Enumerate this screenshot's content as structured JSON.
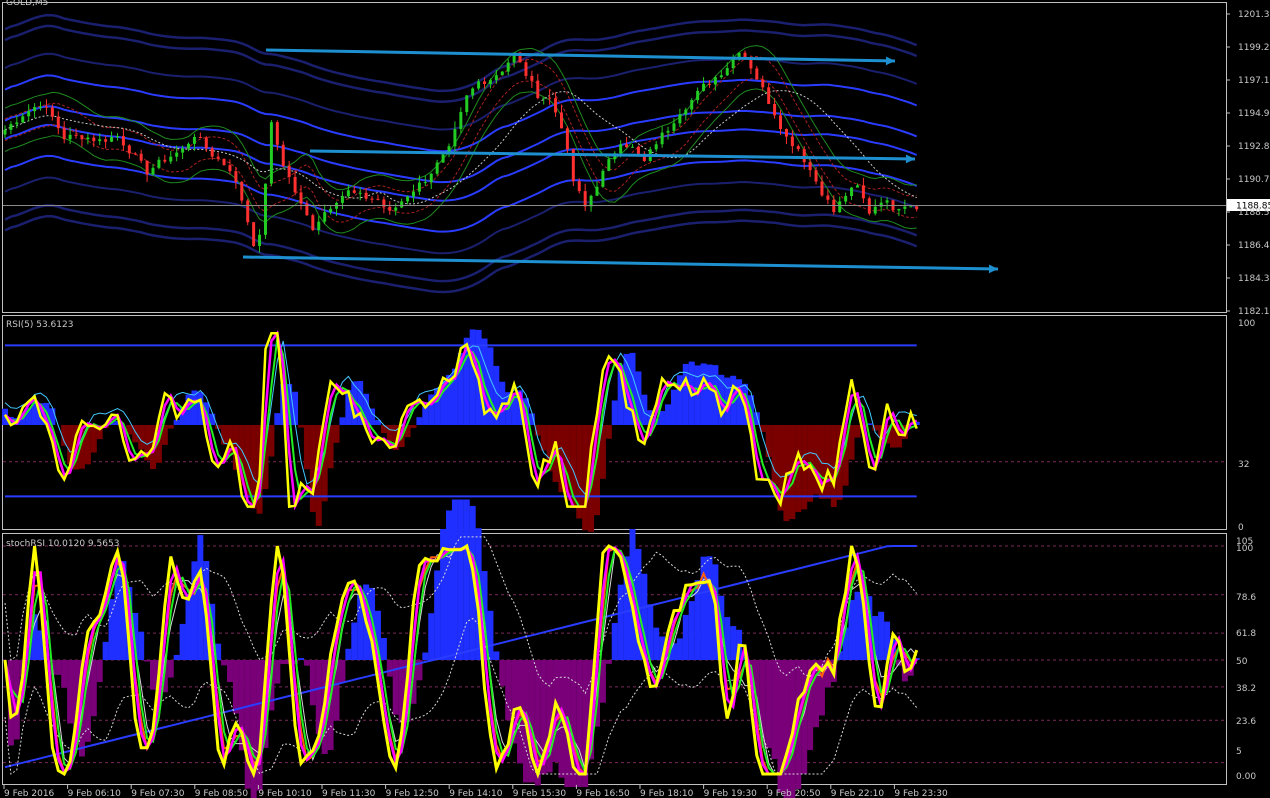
{
  "window": {
    "title_fragment": "GOLD,M5"
  },
  "colors": {
    "background": "#000000",
    "pane_border": "#c0c0c0",
    "bull_candle": "#22cc22",
    "bear_candle": "#ff3030",
    "trend_line": "#1e90d0",
    "band_navy": "#1a1f6e",
    "band_blue": "#2a3cff",
    "rsi_yellow": "#ffff00",
    "rsi_magenta": "#ff00ff",
    "rsi_green": "#22ee22",
    "rsi_cyan": "#44c8ff",
    "hist_pos": "#1f2fff",
    "hist_neg_rsi": "#7a0000",
    "hist_neg_stoch": "#7a007a",
    "stoch_orange": "#ff6010",
    "stoch_white": "#d8d8d8",
    "level_dash": "#7a2a5a"
  },
  "price_pane": {
    "label": "GOLD,M5",
    "current_price": "1188.85",
    "y_ticks": [
      "1201.35",
      "1199.20",
      "1197.10",
      "1194.95",
      "1192.80",
      "1190.70",
      "1188.55",
      "1186.40",
      "1184.30",
      "1182.15"
    ]
  },
  "rsi_pane": {
    "label": "RSI(5) 53.6123",
    "y_ticks": [
      "100",
      "32",
      "0"
    ]
  },
  "stoch_pane": {
    "label": "stochRSI 10.0120 9.5653",
    "y_ticks": [
      "105",
      "100",
      "78.6",
      "61.8",
      "50",
      "38.2",
      "23.6",
      "5",
      "0.00"
    ]
  },
  "x_axis": {
    "ticks": [
      "9 Feb 2016",
      "9 Feb 06:10",
      "9 Feb 07:30",
      "9 Feb 08:50",
      "9 Feb 10:10",
      "9 Feb 11:30",
      "9 Feb 12:50",
      "9 Feb 14:10",
      "9 Feb 15:30",
      "9 Feb 16:50",
      "9 Feb 18:10",
      "9 Feb 19:30",
      "9 Feb 20:50",
      "9 Feb 22:10",
      "9 Feb 23:30"
    ]
  },
  "chart_data": [
    {
      "type": "candlestick",
      "title": "GOLD,M5",
      "ylim": [
        1182.15,
        1202.0
      ],
      "close_points": [
        [
          0,
          1193.8
        ],
        [
          3,
          1194.8
        ],
        [
          6,
          1195.5
        ],
        [
          8,
          1194.6
        ],
        [
          10,
          1193.3
        ],
        [
          13,
          1193.4
        ],
        [
          16,
          1193.1
        ],
        [
          19,
          1193.4
        ],
        [
          21,
          1192.5
        ],
        [
          24,
          1191.1
        ],
        [
          27,
          1191.9
        ],
        [
          30,
          1192.5
        ],
        [
          32,
          1193.5
        ],
        [
          35,
          1192.2
        ],
        [
          38,
          1191.3
        ],
        [
          40,
          1189.3
        ],
        [
          42,
          1186.5
        ],
        [
          43,
          1186.8
        ],
        [
          45,
          1194.1
        ],
        [
          47,
          1191.6
        ],
        [
          50,
          1188.9
        ],
        [
          52,
          1187.5
        ],
        [
          54,
          1188.5
        ],
        [
          56,
          1189.3
        ],
        [
          58,
          1189.8
        ],
        [
          60,
          1189.5
        ],
        [
          63,
          1189.3
        ],
        [
          65,
          1188.4
        ],
        [
          68,
          1189.6
        ],
        [
          71,
          1190.6
        ],
        [
          75,
          1192.5
        ],
        [
          78,
          1195.9
        ],
        [
          80,
          1196.9
        ],
        [
          82,
          1197.1
        ],
        [
          84,
          1197.7
        ],
        [
          86,
          1198.7
        ],
        [
          88,
          1197.4
        ],
        [
          90,
          1196.1
        ],
        [
          92,
          1195.8
        ],
        [
          94,
          1194.1
        ],
        [
          96,
          1190.5
        ],
        [
          98,
          1188.8
        ],
        [
          100,
          1190.3
        ],
        [
          102,
          1191.7
        ],
        [
          104,
          1193.1
        ],
        [
          106,
          1192.6
        ],
        [
          108,
          1191.7
        ],
        [
          110,
          1193.0
        ],
        [
          112,
          1193.9
        ],
        [
          114,
          1195.0
        ],
        [
          116,
          1195.7
        ],
        [
          118,
          1196.6
        ],
        [
          120,
          1197.2
        ],
        [
          122,
          1197.9
        ],
        [
          124,
          1199.0
        ],
        [
          126,
          1197.9
        ],
        [
          128,
          1196.4
        ],
        [
          130,
          1194.9
        ],
        [
          132,
          1193.3
        ],
        [
          134,
          1192.6
        ],
        [
          136,
          1191.2
        ],
        [
          138,
          1189.8
        ],
        [
          140,
          1188.5
        ],
        [
          142,
          1189.6
        ],
        [
          144,
          1190.1
        ],
        [
          146,
          1188.5
        ],
        [
          148,
          1189.3
        ],
        [
          150,
          1188.8
        ],
        [
          152,
          1189.0
        ],
        [
          154,
          1188.9
        ]
      ],
      "trend_lines": [
        "upper channel ~1199.6 to ~1199.0",
        "middle ~1192.8 to ~1192.2",
        "lower ~1186.2 to ~1185.1"
      ]
    },
    {
      "type": "line",
      "title": "RSI(5) 53.6123",
      "ylim": [
        0,
        100
      ],
      "levels": [
        32
      ],
      "series": [
        {
          "name": "RSI(5)",
          "last": 53.6123
        }
      ]
    },
    {
      "type": "line",
      "title": "stochRSI 10.0120 9.5653",
      "ylim": [
        0,
        105
      ],
      "levels": [
        5,
        23.6,
        38.2,
        50,
        61.8,
        78.6,
        100
      ],
      "series": [
        {
          "name": "stochRSI",
          "last": 10.012
        },
        {
          "name": "signal",
          "last": 9.5653
        }
      ]
    }
  ]
}
